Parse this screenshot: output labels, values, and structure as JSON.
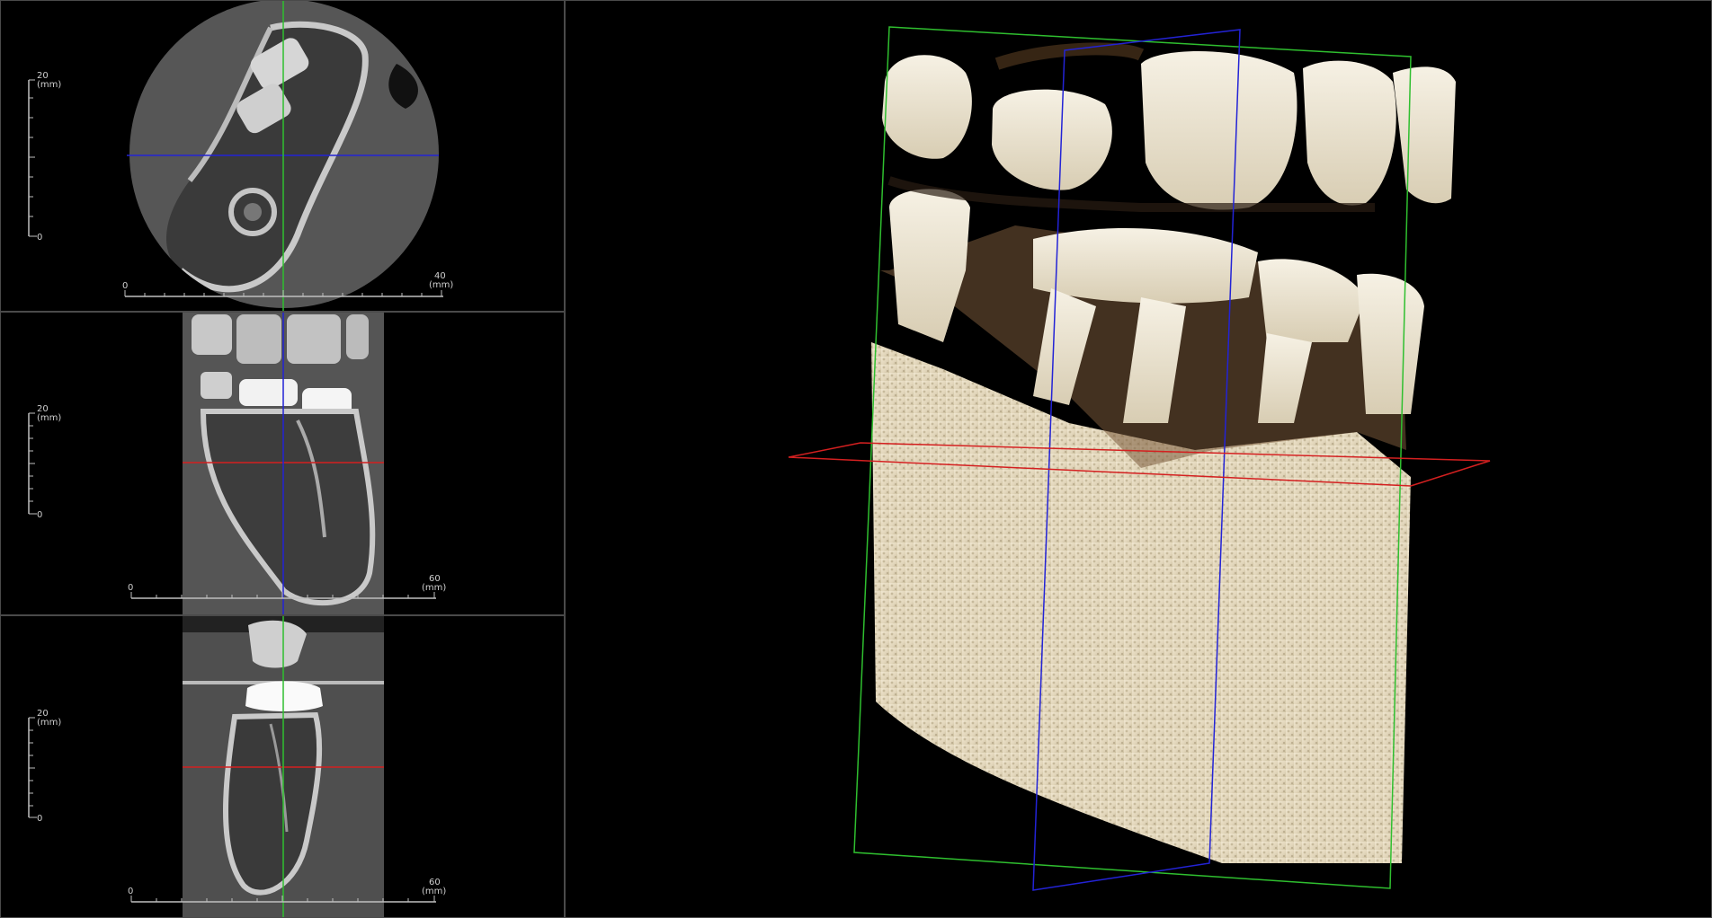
{
  "viewports": {
    "axial": {
      "vertical_scale": {
        "top_label": "20",
        "unit": "(mm)",
        "bottom_label": "0"
      },
      "horizontal_scale": {
        "start_label": "0",
        "end_label": "40",
        "unit": "(mm)"
      },
      "crosshair_colors": {
        "vertical": "#2fbf2f",
        "horizontal": "#2323d6"
      }
    },
    "coronal": {
      "vertical_scale": {
        "top_label": "20",
        "unit": "(mm)",
        "bottom_label": "0"
      },
      "horizontal_scale": {
        "start_label": "0",
        "end_label": "60",
        "unit": "(mm)"
      },
      "crosshair_colors": {
        "vertical": "#2323d6",
        "horizontal": "#d42020"
      }
    },
    "sagittal": {
      "vertical_scale": {
        "top_label": "20",
        "unit": "(mm)",
        "bottom_label": "0"
      },
      "horizontal_scale": {
        "start_label": "0",
        "end_label": "60",
        "unit": "(mm)"
      },
      "crosshair_colors": {
        "vertical": "#2fbf2f",
        "horizontal": "#d42020"
      }
    },
    "volume_3d": {
      "plane_colors": {
        "sagittal": "#2fbf2f",
        "coronal": "#2323d6",
        "axial": "#d42020"
      },
      "bone_color": "#e6dcc6"
    }
  }
}
